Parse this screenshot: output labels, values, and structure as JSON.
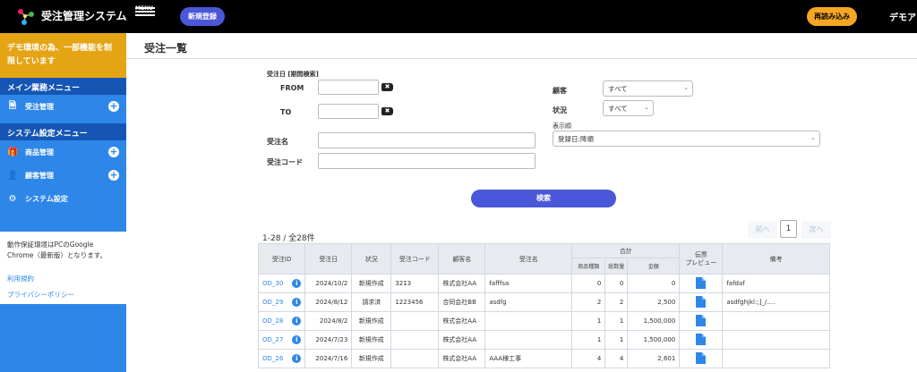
{
  "header": {
    "app_title": "受注管理システム",
    "menu_label": "MENU",
    "new_button": "新規登録",
    "reload_button": "再読み込み",
    "user": "デモアカ"
  },
  "sidebar": {
    "demo_note": "デモ環境の為、一部機能を制限しています",
    "main_menu_title": "メイン業務メニュー",
    "order_mgmt": "受注管理",
    "system_menu_title": "システム設定メニュー",
    "product_mgmt": "商品管理",
    "customer_mgmt": "顧客管理",
    "system_settings": "システム設定",
    "env_note": "動作保証環境はPCのGoogle Chrome（最新版）となります。",
    "terms": "利用規約",
    "privacy": "プライバシーポリシー"
  },
  "page": {
    "title": "受注一覧"
  },
  "search": {
    "date_label": "受注日 [期間検索]",
    "from": "FROM",
    "to": "TO",
    "clear": "✖",
    "name_label": "受注名",
    "code_label": "受注コード",
    "customer_label": "顧客",
    "customer_value": "すべて",
    "status_label": "状況",
    "status_value": "すべて",
    "sort_label": "表示順",
    "sort_value": "登録日:降順",
    "search_button": "検索"
  },
  "list": {
    "count": "1-28 / 全28件",
    "prev": "前へ",
    "page": "1",
    "next": "次へ",
    "headers": {
      "id": "受注ID",
      "date": "受注日",
      "status": "状況",
      "code": "受注コード",
      "customer": "顧客名",
      "name": "受注名",
      "total": "合計",
      "types": "商品種類",
      "qty": "総数量",
      "amount": "金額",
      "preview": "伝票\nプレビュー",
      "note": "備考"
    },
    "rows": [
      {
        "id": "OD_30",
        "date": "2024/10/2",
        "status": "新規作成",
        "code": "3213",
        "customer": "株式会社AA",
        "name": "fafffsa",
        "types": "0",
        "qty": "0",
        "amount": "0",
        "note": "fafdaf"
      },
      {
        "id": "OD_29",
        "date": "2024/8/12",
        "status": "請求済",
        "code": "1223456",
        "customer": "合同会社BB",
        "name": "asdfg",
        "types": "2",
        "qty": "2",
        "amount": "2,500",
        "note": "asdfghjkl:;]_/.…"
      },
      {
        "id": "OD_28",
        "date": "2024/8/2",
        "status": "新規作成",
        "code": "",
        "customer": "株式会社AA",
        "name": "",
        "types": "1",
        "qty": "1",
        "amount": "1,500,000",
        "note": ""
      },
      {
        "id": "OD_27",
        "date": "2024/7/23",
        "status": "新規作成",
        "code": "",
        "customer": "株式会社AA",
        "name": "",
        "types": "1",
        "qty": "1",
        "amount": "1,500,000",
        "note": ""
      },
      {
        "id": "OD_26",
        "date": "2024/7/16",
        "status": "新規作成",
        "code": "",
        "customer": "株式会社AA",
        "name": "AAA様工事",
        "types": "4",
        "qty": "4",
        "amount": "2,601",
        "note": ""
      }
    ]
  }
}
